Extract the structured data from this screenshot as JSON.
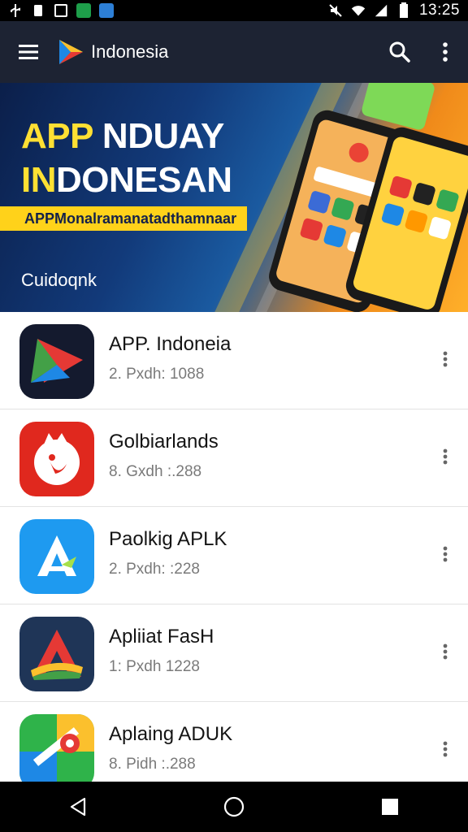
{
  "status_bar": {
    "time": "13:25",
    "icons": [
      "usb-icon",
      "sim-icon",
      "notification-icon",
      "app-green-icon",
      "app-blue-icon",
      "mute-icon",
      "wifi-icon",
      "signal-icon",
      "battery-icon"
    ]
  },
  "app_bar": {
    "title": "Indonesia",
    "logo_icon": "play-triangle-logo",
    "search_icon": "search-icon",
    "more_icon": "more-vert-icon",
    "menu_icon": "menu-icon"
  },
  "banner": {
    "line1_yellow": "APP",
    "line1_white": "NDUAY",
    "line2_yellow": "IN",
    "line2_white": "DONESAN",
    "strip_text": "APPMonalramanatadthamnaar",
    "subtitle": "Cuidoqnk"
  },
  "apps": [
    {
      "name": "APP. Indoneia",
      "meta": "2. Pxdh: 1088",
      "icon": "play-triangle-icon",
      "colors": [
        "#141a2e",
        "#e53935",
        "#43a047",
        "#1e88e5"
      ]
    },
    {
      "name": "Golbiarlands",
      "meta": "8. Gxdh :.288",
      "icon": "mascot-icon",
      "colors": [
        "#e0281e",
        "#ffffff"
      ]
    },
    {
      "name": "Paolkig APLK",
      "meta": "2. Pxdh: :228",
      "icon": "letter-a-icon",
      "colors": [
        "#1e9af0",
        "#ffffff",
        "#a6e04a"
      ]
    },
    {
      "name": "Apliiat FasH",
      "meta": "1: Pxdh 1228",
      "icon": "triangle-a-icon",
      "colors": [
        "#1f3557",
        "#e53935",
        "#fbc02d",
        "#43a047"
      ]
    },
    {
      "name": "Aplaing ADUK",
      "meta": "8. Pidh :.288",
      "icon": "map-pin-icon",
      "colors": [
        "#2fb34a",
        "#ffffff",
        "#1e88e5",
        "#e53935"
      ]
    }
  ],
  "nav_bar": {
    "back_icon": "back-icon",
    "home_icon": "home-icon",
    "recents_icon": "recents-icon"
  }
}
